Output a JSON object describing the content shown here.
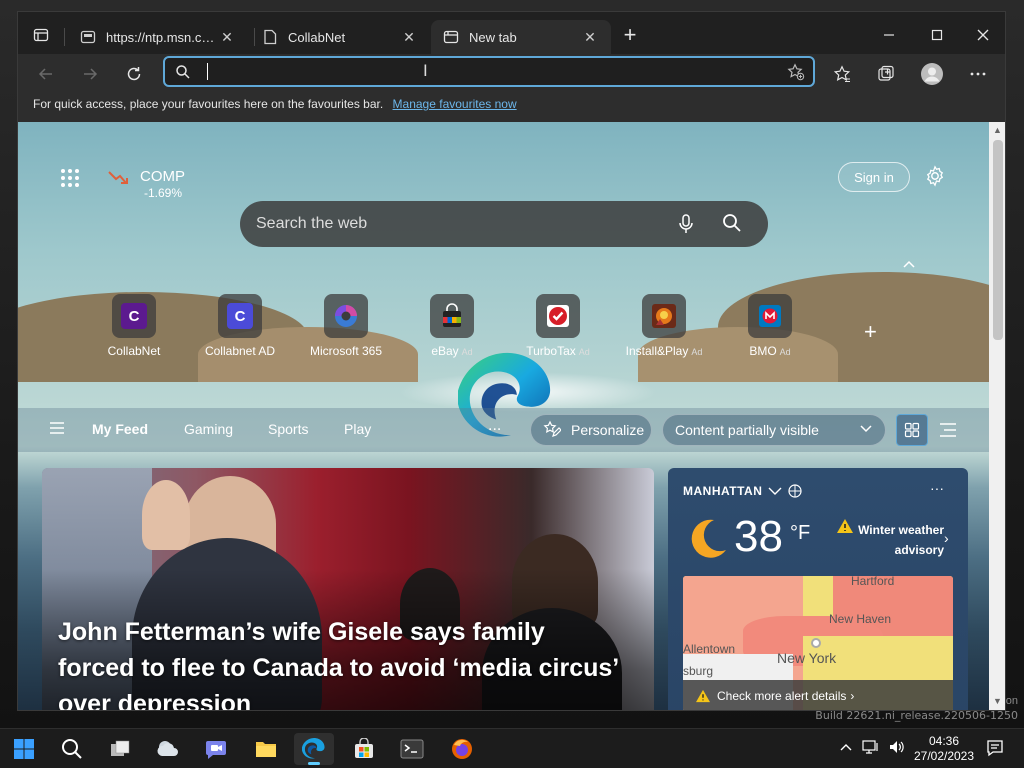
{
  "tabs": [
    {
      "title": "https://ntp.msn.com/edge/ntp",
      "favicon": "page-icon"
    },
    {
      "title": "CollabNet",
      "favicon": "document-icon"
    },
    {
      "title": "New tab",
      "favicon": "newtab-icon",
      "active": true
    }
  ],
  "addressbar": {
    "value": "",
    "placeholder": ""
  },
  "favbar": {
    "message": "For quick access, place your favourites here on the favourites bar.",
    "link": "Manage favourites now"
  },
  "ntp": {
    "stock": {
      "symbol": "COMP",
      "change": "-1.69%"
    },
    "signin": "Sign in",
    "search_placeholder": "Search the web",
    "quicklinks": [
      {
        "label": "CollabNet",
        "ad": "",
        "icon": "C",
        "color": "#5c1a8f"
      },
      {
        "label": "Collabnet AD",
        "ad": "",
        "icon": "C",
        "color": "#4b4bd8"
      },
      {
        "label": "Microsoft 365",
        "ad": "",
        "icon": "m365",
        "color": "#6a5bd6"
      },
      {
        "label": "eBay",
        "ad": "Ad",
        "icon": "bag",
        "color": "#333"
      },
      {
        "label": "TurboTax",
        "ad": "Ad",
        "icon": "check",
        "color": "#d71e28"
      },
      {
        "label": "Install&Play",
        "ad": "Ad",
        "icon": "game",
        "color": "#a33"
      },
      {
        "label": "BMO",
        "ad": "Ad",
        "icon": "M",
        "color": "#0079c1"
      }
    ],
    "feed": {
      "tabs": [
        "My Feed",
        "Gaming",
        "Sports",
        "Play"
      ],
      "more": "...",
      "personalize": "Personalize",
      "content_visibility": "Content partially visible"
    },
    "news": {
      "headline": "John Fetterman’s wife Gisele says family forced to flee to Canada to avoid ‘media circus’ over depression"
    },
    "weather": {
      "location": "MANHATTAN",
      "temp": "38",
      "unit": "°F",
      "alert": "Winter weather advisory",
      "alert_link": "Check more alert details",
      "map_labels": {
        "hartford": "Hartford",
        "new_haven": "New Haven",
        "allentown": "Allentown",
        "new_york": "New York",
        "burg": "sburg"
      }
    }
  },
  "desktop": {
    "edge_text": "on",
    "build": "Build 22621.ni_release.220506-1250"
  },
  "taskbar": {
    "time": "04:36",
    "date": "27/02/2023"
  }
}
